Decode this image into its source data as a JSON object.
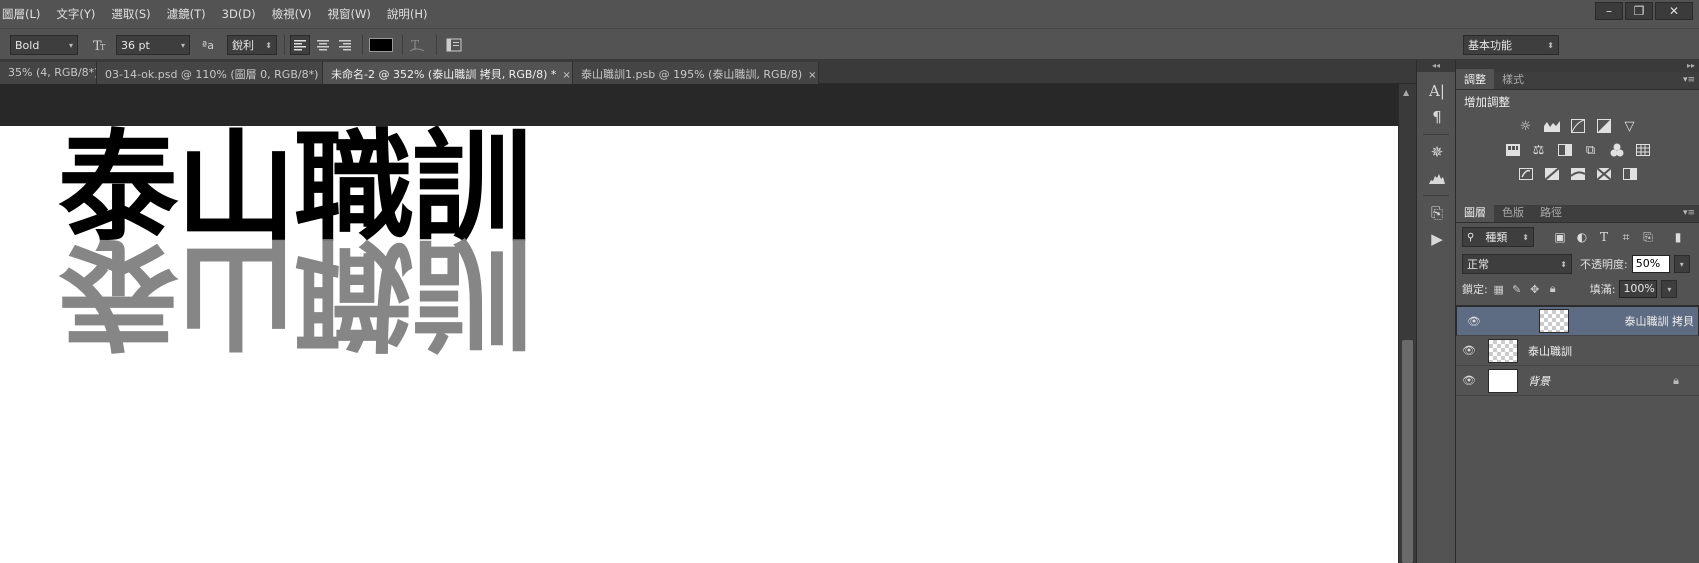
{
  "menubar": {
    "items": [
      "圖層(L)",
      "文字(Y)",
      "選取(S)",
      "濾鏡(T)",
      "3D(D)",
      "檢視(V)",
      "視窗(W)",
      "說明(H)"
    ],
    "window_controls": {
      "minimize": "–",
      "restore": "❐",
      "close": "✕"
    }
  },
  "options_bar": {
    "font_style": "Bold",
    "font_size": "36 pt",
    "antialias_glyph": "ªa",
    "antialias": "銳利",
    "text_color": "#000000",
    "workspace": "基本功能"
  },
  "tabs": [
    {
      "label": "35% (4, RGB/8*)",
      "close": "×"
    },
    {
      "label": "03-14-ok.psd @ 110% (圖層 0, RGB/8*)",
      "close": "×"
    },
    {
      "label": "未命名-2 @ 352% (泰山職訓 拷貝, RGB/8) *",
      "close": "×",
      "active": true
    },
    {
      "label": "泰山職訓1.psb @ 195% (泰山職訓, RGB/8)",
      "close": "×"
    }
  ],
  "canvas": {
    "main_text": "泰山職訓",
    "reflection_text": "泰山職訓"
  },
  "adjustments_panel": {
    "tabs": [
      "調整",
      "樣式"
    ],
    "title": "增加調整"
  },
  "layers_panel": {
    "tabs": [
      "圖層",
      "色版",
      "路徑"
    ],
    "filter": "種類",
    "blend_mode": "正常",
    "opacity_label": "不透明度:",
    "opacity_value": "50%",
    "lock_label": "鎖定:",
    "fill_label": "填滿:",
    "fill_value": "100%",
    "layers": [
      {
        "name": "泰山職訓 拷貝",
        "selected": true
      },
      {
        "name": "泰山職訓",
        "selected": false
      },
      {
        "name": "背景",
        "selected": false
      }
    ]
  },
  "colors": {
    "selected_layer": "#5d6c82",
    "reflection_gray": "#808080"
  }
}
